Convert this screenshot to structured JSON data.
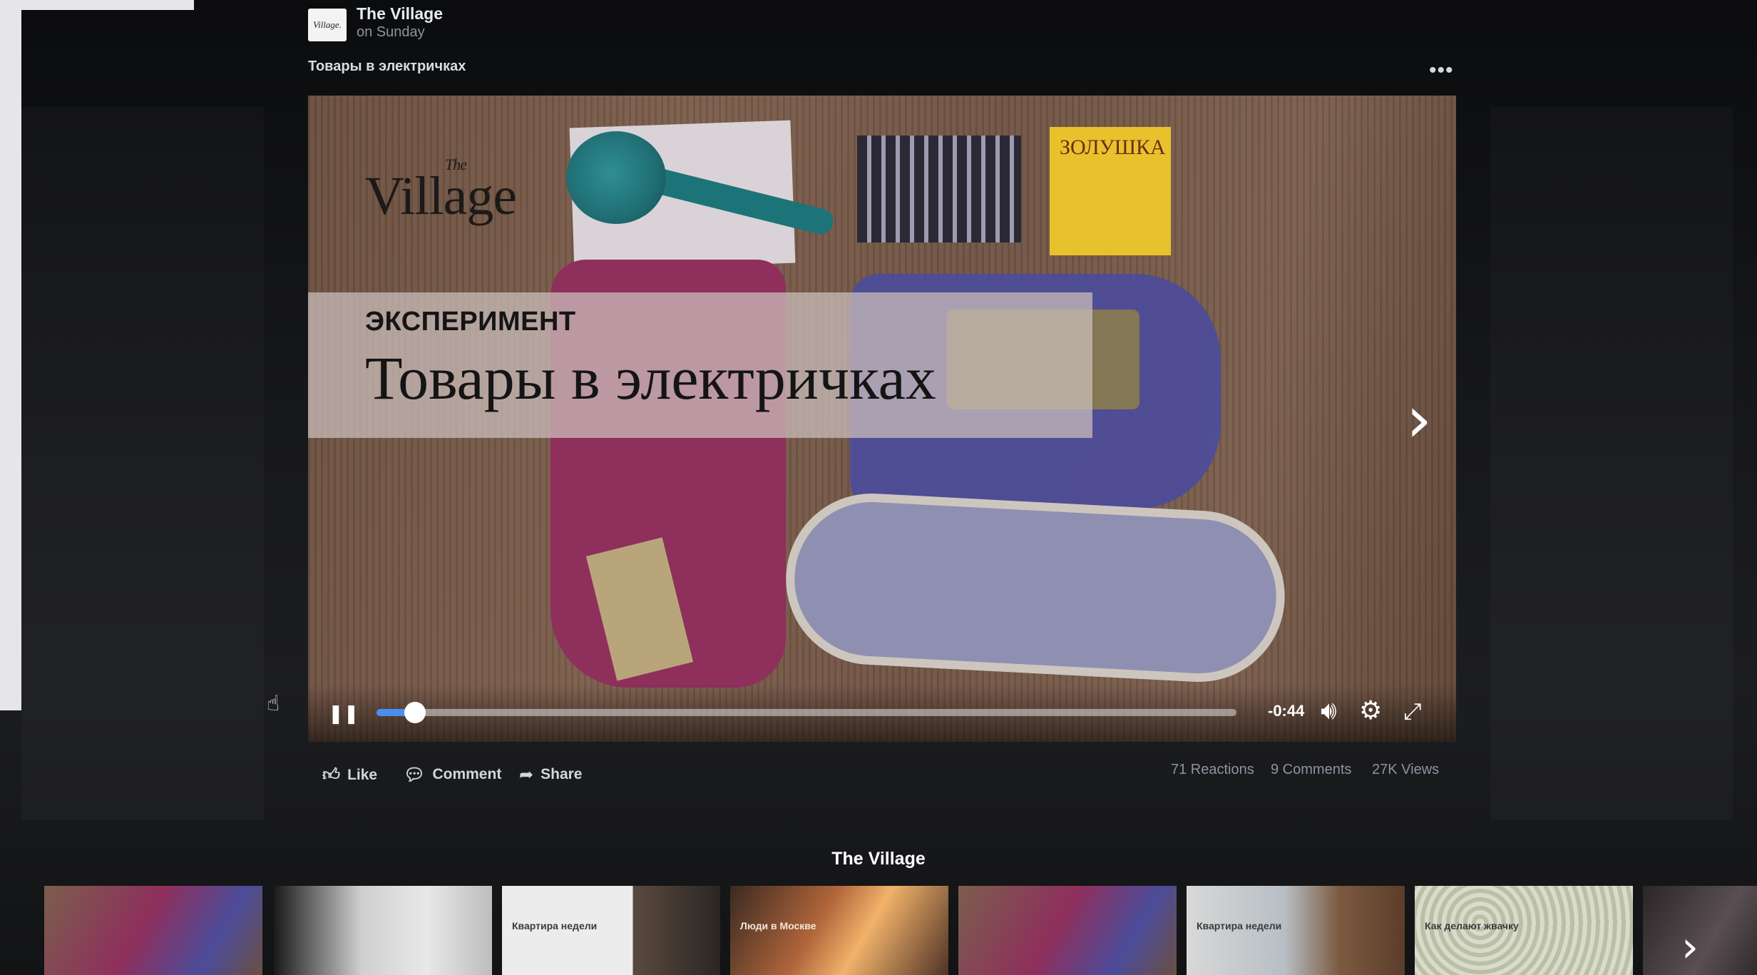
{
  "post": {
    "page_logo_text": "Village.",
    "page_name": "The Village",
    "time": "on Sunday",
    "text": "Товары в электричках",
    "more_icon": "more-dots-icon"
  },
  "video": {
    "brand_logo": "Village",
    "brand_logo_prefix": "The",
    "product_box_label": "ЗОЛУШКА",
    "kicker": "ЭКСПЕРИМЕНТ",
    "title": "Товары в электричках",
    "next_icon": "chevron-right-icon",
    "controls": {
      "pause_icon": "pause-icon",
      "progress": 0.045,
      "time_remaining": "-0:44",
      "volume_icon": "volume-icon",
      "settings_icon": "gear-icon",
      "fullscreen_icon": "fullscreen-icon"
    },
    "accent_color": "#4a8ef0"
  },
  "actions": {
    "like": "Like",
    "comment": "Comment",
    "share": "Share"
  },
  "stats": {
    "reactions": "71 Reactions",
    "comments": "9 Comments",
    "views": "27K Views"
  },
  "related": {
    "title": "The Village",
    "items": [
      {
        "caption": ""
      },
      {
        "caption": ""
      },
      {
        "caption": "Квартира недели"
      },
      {
        "caption": "Люди в Москве"
      },
      {
        "caption": ""
      },
      {
        "caption": "Квартира недели"
      },
      {
        "caption": "Как делают жвачку"
      },
      {
        "caption": ""
      }
    ],
    "next_icon": "chevron-right-icon"
  }
}
